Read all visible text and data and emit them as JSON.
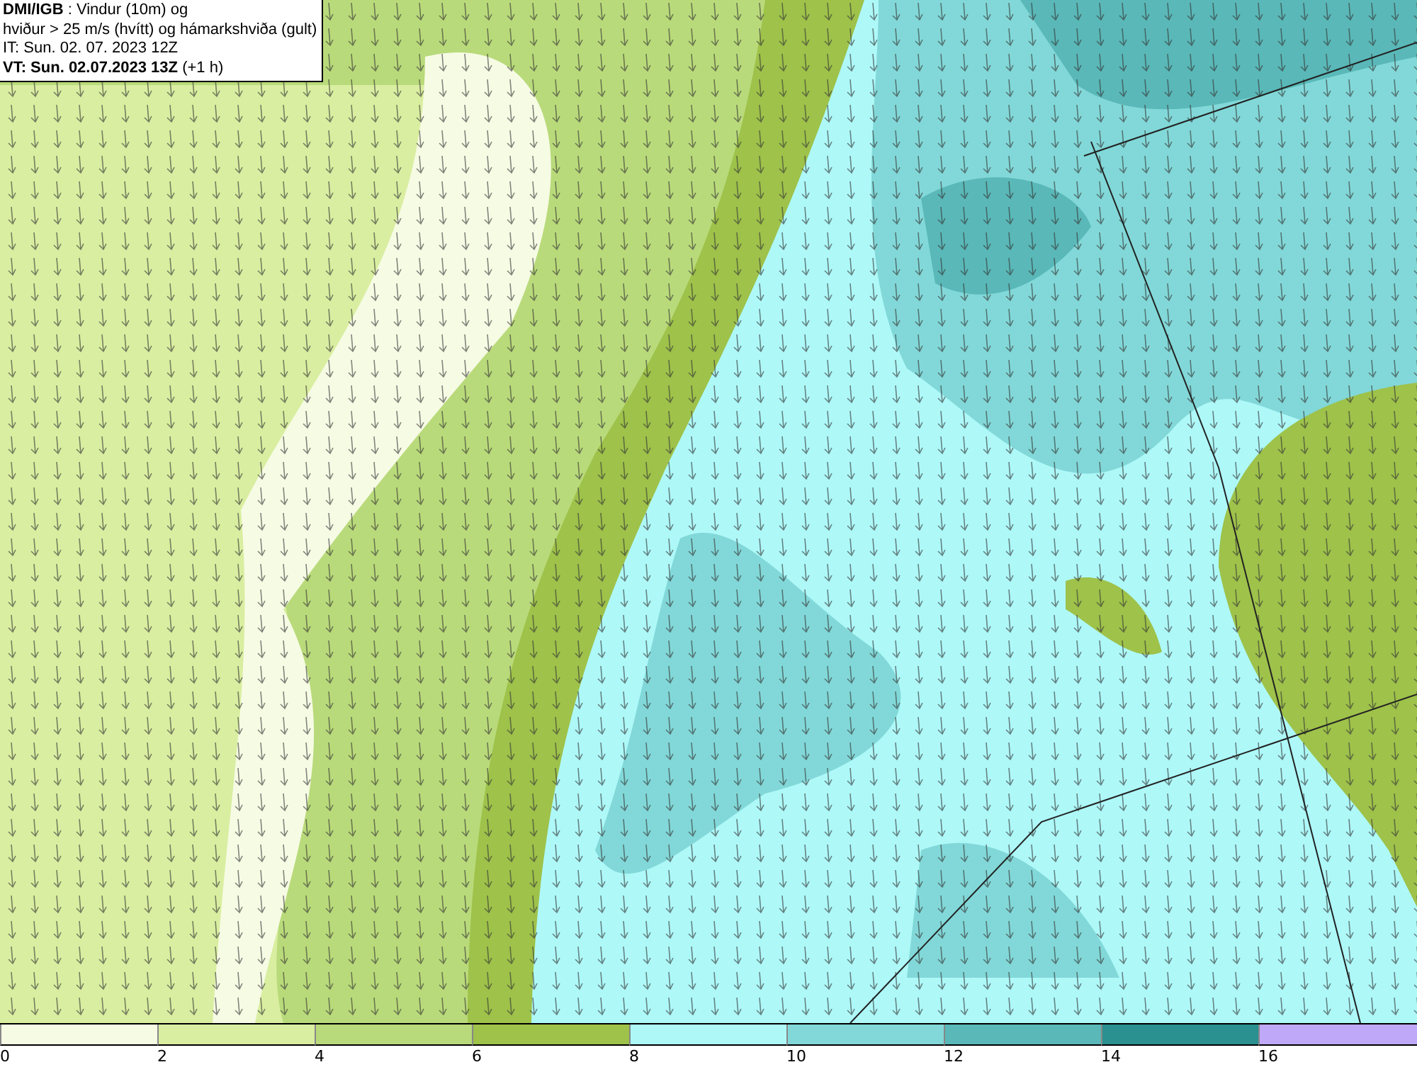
{
  "title_box": {
    "lines": [
      "**DMI/IGB** : Vindur (10m) og",
      "hviður > 25 m/s (hvítt) og hámarkshviða (gult)",
      "IT: Sun. 02. 07. 2023 12Z",
      "**VT: Sun. 02.07.2023 13Z** (+1 h)"
    ]
  },
  "legend": {
    "bins": [
      {
        "label": "0",
        "color": "#f6fbe4"
      },
      {
        "label": "2",
        "color": "#d9eea0"
      },
      {
        "label": "4",
        "color": "#b9da7a"
      },
      {
        "label": "6",
        "color": "#9ec24a"
      },
      {
        "label": "8",
        "color": "#aef8f8"
      },
      {
        "label": "10",
        "color": "#82d8d8"
      },
      {
        "label": "12",
        "color": "#5ab8b8"
      },
      {
        "label": "14",
        "color": "#2a9090"
      },
      {
        "label": "16",
        "color": "#c0a8f8"
      }
    ]
  }
}
